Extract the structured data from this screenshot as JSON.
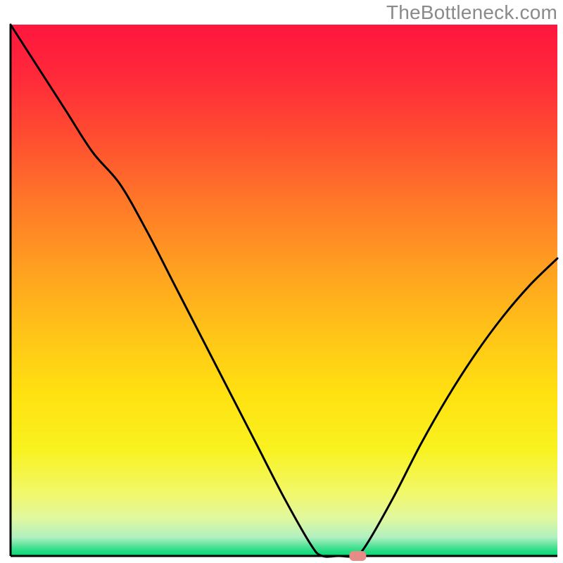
{
  "watermark": "TheBottleneck.com",
  "chart_data": {
    "type": "line",
    "title": "",
    "xlabel": "",
    "ylabel": "",
    "xlim": [
      0,
      100
    ],
    "ylim": [
      0,
      100
    ],
    "x": [
      0,
      5,
      10,
      15,
      20,
      25,
      30,
      35,
      40,
      45,
      50,
      55,
      57,
      60,
      63,
      65,
      70,
      75,
      80,
      85,
      90,
      95,
      100
    ],
    "values": [
      100,
      92,
      84,
      76,
      70,
      61,
      51,
      41,
      31,
      21,
      11,
      2,
      0,
      0,
      0,
      2,
      11,
      21,
      30,
      38,
      45,
      51,
      56
    ],
    "baseline_y": 0,
    "marker": {
      "x": 63.5,
      "y": 0
    },
    "gradient_stops": [
      {
        "offset": 0.0,
        "color": "#ff163e"
      },
      {
        "offset": 0.1,
        "color": "#ff2a3a"
      },
      {
        "offset": 0.22,
        "color": "#ff5030"
      },
      {
        "offset": 0.34,
        "color": "#ff7a28"
      },
      {
        "offset": 0.46,
        "color": "#ffa020"
      },
      {
        "offset": 0.58,
        "color": "#ffc418"
      },
      {
        "offset": 0.7,
        "color": "#ffe210"
      },
      {
        "offset": 0.8,
        "color": "#f8f220"
      },
      {
        "offset": 0.88,
        "color": "#f2f868"
      },
      {
        "offset": 0.93,
        "color": "#e0f8a0"
      },
      {
        "offset": 0.965,
        "color": "#b0f0c0"
      },
      {
        "offset": 0.985,
        "color": "#40e090"
      },
      {
        "offset": 1.0,
        "color": "#00d870"
      }
    ]
  }
}
